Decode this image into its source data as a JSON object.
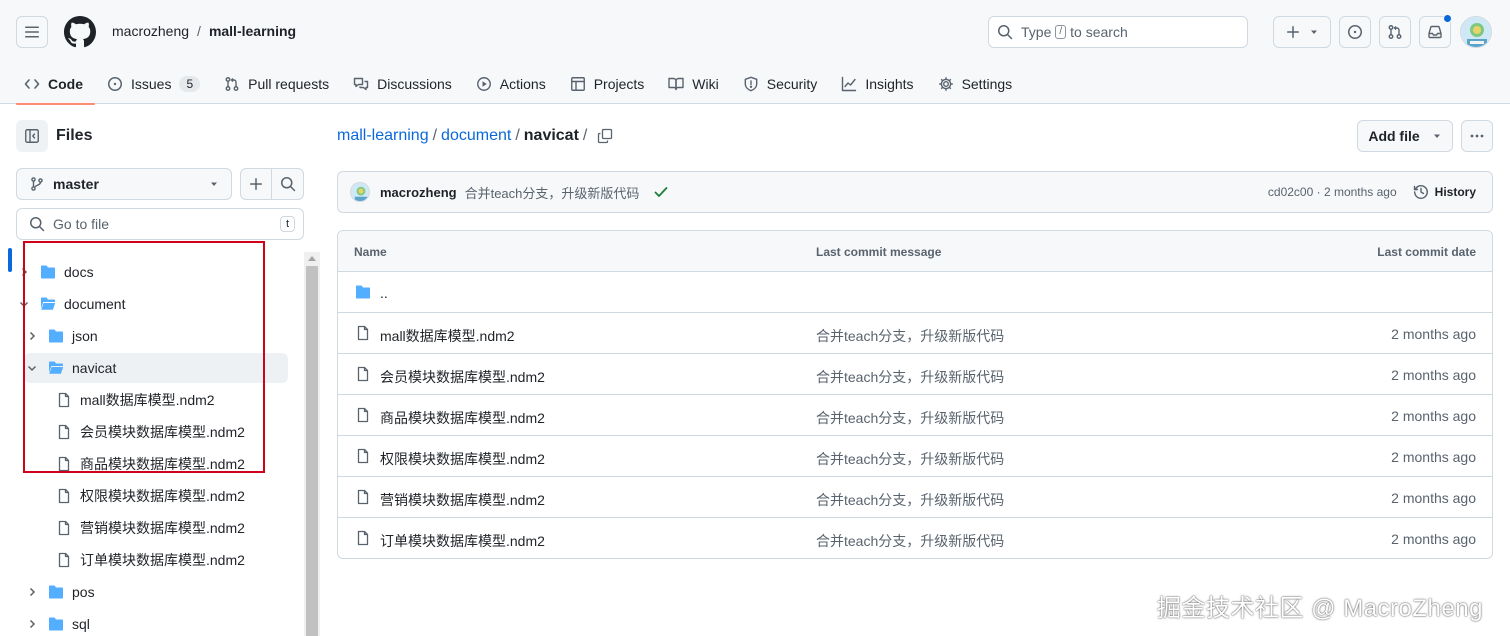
{
  "header": {
    "owner": "macrozheng",
    "separator": "/",
    "repo": "mall-learning",
    "search": {
      "prefix": "Type",
      "key": "/",
      "suffix": "to search"
    }
  },
  "tabs": [
    {
      "label": "Code",
      "icon": "code-icon",
      "active": true
    },
    {
      "label": "Issues",
      "icon": "issue-opened-icon",
      "count": "5"
    },
    {
      "label": "Pull requests",
      "icon": "git-pull-request-icon"
    },
    {
      "label": "Discussions",
      "icon": "comment-discussion-icon"
    },
    {
      "label": "Actions",
      "icon": "play-icon"
    },
    {
      "label": "Projects",
      "icon": "table-icon"
    },
    {
      "label": "Wiki",
      "icon": "book-icon"
    },
    {
      "label": "Security",
      "icon": "shield-icon"
    },
    {
      "label": "Insights",
      "icon": "graph-icon"
    },
    {
      "label": "Settings",
      "icon": "gear-icon"
    }
  ],
  "sidebar": {
    "title": "Files",
    "branch": "master",
    "goto_placeholder": "Go to file",
    "goto_key": "t",
    "tree": [
      {
        "label": "docs",
        "type": "folder",
        "expanded": false,
        "depth": 0
      },
      {
        "label": "document",
        "type": "folder",
        "expanded": true,
        "depth": 0
      },
      {
        "label": "json",
        "type": "folder",
        "expanded": false,
        "depth": 1
      },
      {
        "label": "navicat",
        "type": "folder",
        "expanded": true,
        "depth": 1,
        "selected": true
      },
      {
        "label": "mall数据库模型.ndm2",
        "type": "file",
        "depth": 2
      },
      {
        "label": "会员模块数据库模型.ndm2",
        "type": "file",
        "depth": 2
      },
      {
        "label": "商品模块数据库模型.ndm2",
        "type": "file",
        "depth": 2
      },
      {
        "label": "权限模块数据库模型.ndm2",
        "type": "file",
        "depth": 2
      },
      {
        "label": "营销模块数据库模型.ndm2",
        "type": "file",
        "depth": 2
      },
      {
        "label": "订单模块数据库模型.ndm2",
        "type": "file",
        "depth": 2
      },
      {
        "label": "pos",
        "type": "folder",
        "expanded": false,
        "depth": 1
      },
      {
        "label": "sql",
        "type": "folder",
        "expanded": false,
        "depth": 1
      }
    ]
  },
  "main": {
    "path": {
      "root": "mall-learning",
      "parent": "document",
      "current": "navicat",
      "sep": "/"
    },
    "add_file": "Add file",
    "commit": {
      "author": "macrozheng",
      "message": "合并teach分支，升级新版代码",
      "meta": "cd02c00 · 2 months ago",
      "history": "History"
    },
    "table": {
      "headers": {
        "name": "Name",
        "message": "Last commit message",
        "date": "Last commit date"
      },
      "parent_label": "..",
      "rows": [
        {
          "name": "mall数据库模型.ndm2",
          "message": "合并teach分支，升级新版代码",
          "date": "2 months ago"
        },
        {
          "name": "会员模块数据库模型.ndm2",
          "message": "合并teach分支，升级新版代码",
          "date": "2 months ago"
        },
        {
          "name": "商品模块数据库模型.ndm2",
          "message": "合并teach分支，升级新版代码",
          "date": "2 months ago"
        },
        {
          "name": "权限模块数据库模型.ndm2",
          "message": "合并teach分支，升级新版代码",
          "date": "2 months ago"
        },
        {
          "name": "营销模块数据库模型.ndm2",
          "message": "合并teach分支，升级新版代码",
          "date": "2 months ago"
        },
        {
          "name": "订单模块数据库模型.ndm2",
          "message": "合并teach分支，升级新版代码",
          "date": "2 months ago"
        }
      ]
    }
  },
  "watermark": "掘金技术社区 @ MacroZheng",
  "colors": {
    "accent": "#0969da",
    "tab_underline": "#fd8c73",
    "folder": "#54aeff",
    "highlight_box": "#d0021b",
    "check": "#1a7f37"
  }
}
